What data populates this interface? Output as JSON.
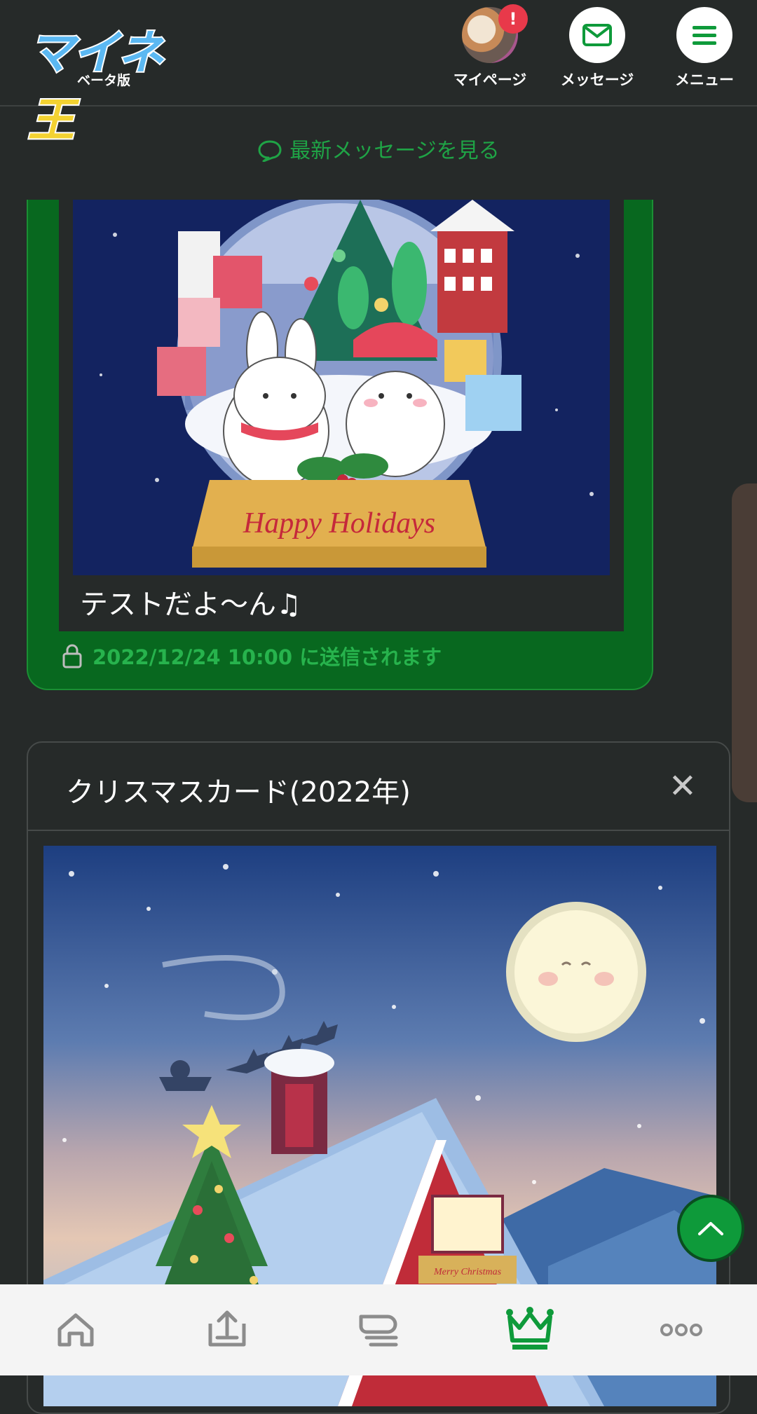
{
  "header": {
    "logo_text": "マイネ",
    "logo_text_king": "王",
    "logo_sub": "ベータ版",
    "mypage_label": "マイページ",
    "mypage_badge": "!",
    "message_label": "メッセージ",
    "menu_label": "メニュー"
  },
  "latest_link": "最新メッセージを見る",
  "sent_card": {
    "image_caption": "Happy Holidays",
    "message": "テストだよ〜ん♫",
    "status": "2022/12/24 10:00 に送信されます"
  },
  "card_modal": {
    "title": "クリスマスカード(2022年)",
    "close_glyph": "✕",
    "sign_text": "Merry Christmas"
  },
  "colors": {
    "accent": "#1fa446",
    "card_green": "#08681f",
    "background": "#262a29",
    "badge": "#e8394a",
    "nav_bg": "#f4f4f4"
  },
  "bottom_nav": [
    {
      "name": "home-icon"
    },
    {
      "name": "upload-icon"
    },
    {
      "name": "messages-icon"
    },
    {
      "name": "crown-icon",
      "active": true
    },
    {
      "name": "more-icon"
    }
  ]
}
